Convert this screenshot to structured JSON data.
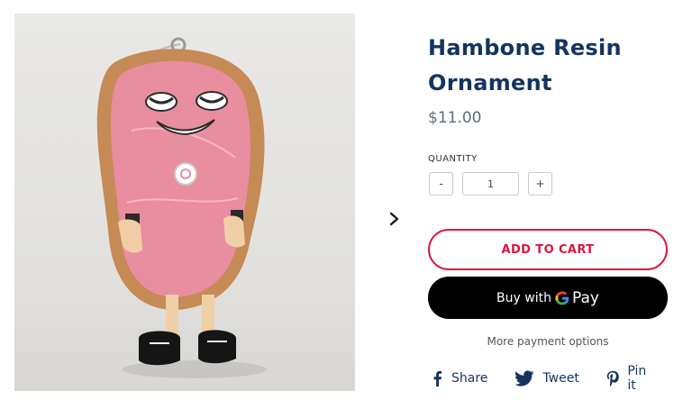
{
  "product": {
    "title_line1": "Hambone Resin",
    "title_line2": "Ornament",
    "price": "$11.00",
    "image_icon": "product-photo-hambone-ornament"
  },
  "gallery": {
    "next_icon": "chevron-right-icon"
  },
  "quantity": {
    "label": "QUANTITY",
    "minus_label": "-",
    "plus_label": "+",
    "value": "1"
  },
  "buttons": {
    "add_to_cart": "ADD TO CART",
    "buy_with_label": "Buy with",
    "pay_word": "Pay",
    "more_payment_options": "More payment options"
  },
  "share": {
    "items": [
      {
        "label": "Share",
        "icon": "facebook-icon"
      },
      {
        "label": "Tweet",
        "icon": "twitter-icon"
      },
      {
        "label": "Pin it",
        "icon": "pinterest-icon"
      }
    ]
  },
  "colors": {
    "title": "#14345f",
    "accent": "#d8163f",
    "price": "#5b6c83",
    "pay_button_bg": "#000000"
  }
}
